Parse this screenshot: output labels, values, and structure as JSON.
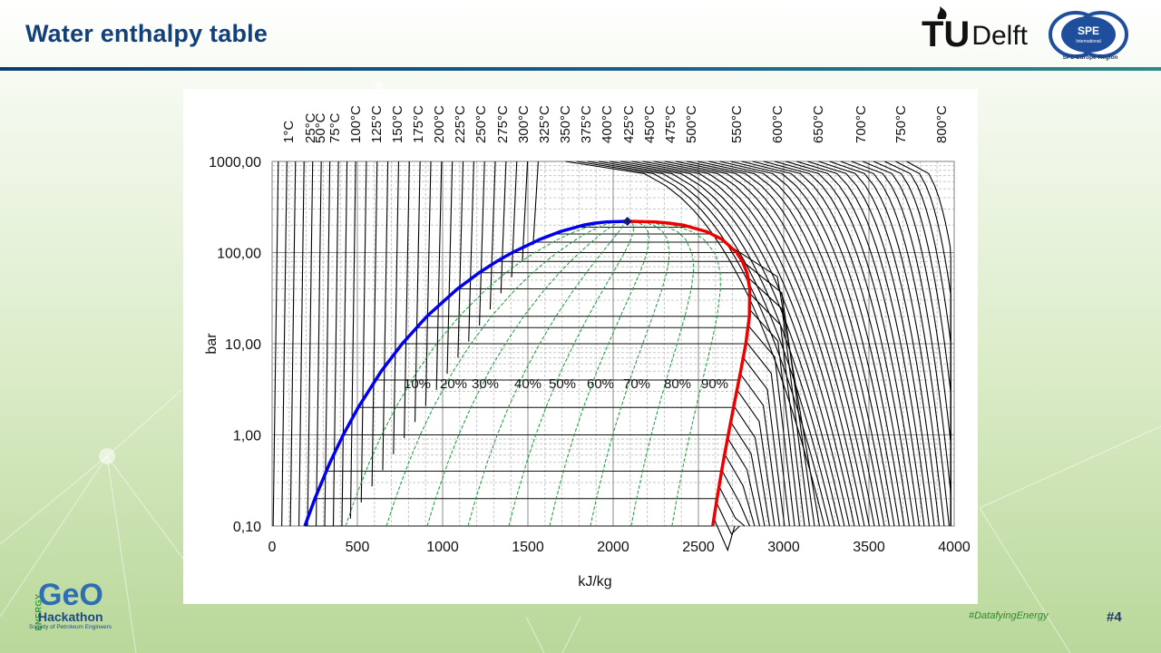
{
  "slide": {
    "title": "Water enthalpy table",
    "hashtag": "#DatafyingEnergy",
    "page_number": "#4"
  },
  "logos": {
    "tudelft_prefix": "TU",
    "tudelft_name": "Delft",
    "spe_mark": "SPE",
    "spe_sub": "International",
    "spe_region": "SPE Europe Region",
    "geo_energy": "ENERGY",
    "geo_word": "GeO",
    "geo_hackathon": "Hackathon",
    "geo_society": "Society of Petroleum Engineers"
  },
  "colors": {
    "title": "#12407a",
    "saturated_liquid": "#0000ee",
    "saturated_vapor": "#ee0000",
    "quality_lines": "#1a9a3a",
    "isotherms": "#000000",
    "critical_point": "#1a1a6a"
  },
  "chart_data": {
    "type": "line",
    "xlabel": "kJ/kg",
    "ylabel": "bar",
    "xlim": [
      0,
      4000
    ],
    "ylim": [
      0.1,
      1000
    ],
    "y_scale": "log",
    "x_ticks": [
      "0",
      "500",
      "1000",
      "1500",
      "2000",
      "2500",
      "3000",
      "3500",
      "4000"
    ],
    "y_ticks": [
      "0,10",
      "1,00",
      "10,00",
      "100,00",
      "1000,00"
    ],
    "grid": true,
    "isotherm_labels": [
      "1°C",
      "25°C",
      "50°C",
      "75°C",
      "100°C",
      "125°C",
      "150°C",
      "175°C",
      "200°C",
      "225°C",
      "250°C",
      "275°C",
      "300°C",
      "325°C",
      "350°C",
      "375°C",
      "400°C",
      "425°C",
      "450°C",
      "475°C",
      "500°C",
      "550°C",
      "600°C",
      "650°C",
      "700°C",
      "750°C",
      "800°C"
    ],
    "quality_labels": [
      "10%",
      "20%",
      "30%",
      "40%",
      "50%",
      "60%",
      "70%",
      "80%",
      "90%"
    ],
    "critical_point": {
      "h": 2084,
      "p": 220.6
    },
    "saturated_liquid": {
      "h": [
        192,
        251,
        340,
        417,
        505,
        640,
        763,
        908,
        1087,
        1213,
        1317,
        1408,
        1571,
        1690,
        1826,
        1890,
        1960,
        2084
      ],
      "p": [
        0.1,
        0.2,
        0.5,
        1.0,
        2.0,
        5.0,
        10,
        20,
        40,
        60,
        80,
        100,
        140,
        170,
        200,
        210,
        217,
        220.6
      ]
    },
    "saturated_vapor": {
      "h": [
        2584,
        2609,
        2645,
        2675,
        2706,
        2748,
        2778,
        2799,
        2801,
        2785,
        2758,
        2725,
        2638,
        2547,
        2412,
        2330,
        2250,
        2084
      ],
      "p": [
        0.1,
        0.2,
        0.5,
        1.0,
        2.0,
        5.0,
        10,
        20,
        40,
        60,
        80,
        100,
        140,
        170,
        200,
        210,
        217,
        220.6
      ]
    },
    "isobar_pressures": [
      0.1,
      0.2,
      0.4,
      1,
      2,
      4,
      10,
      15,
      20,
      40,
      60,
      80,
      100,
      130,
      160,
      190
    ]
  }
}
